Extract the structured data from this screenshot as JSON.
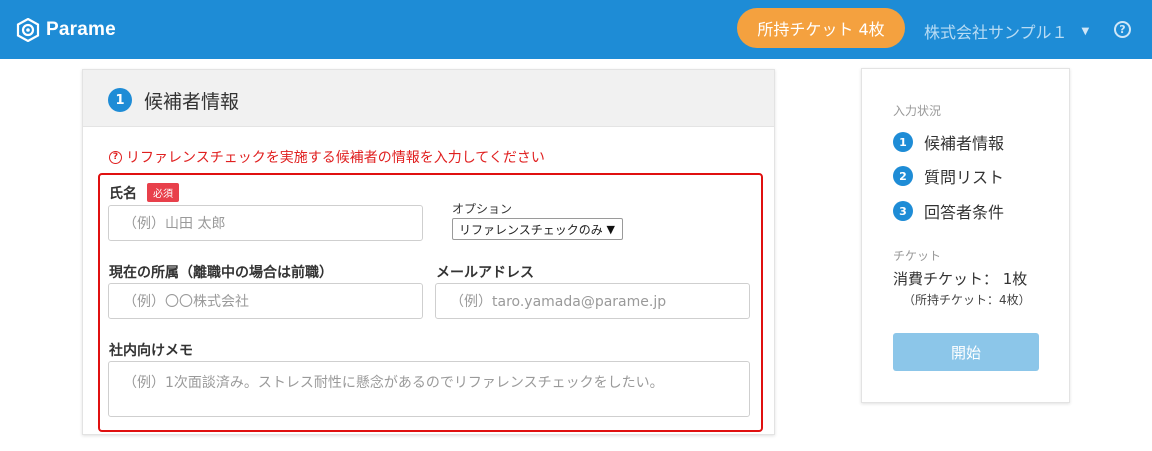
{
  "header": {
    "logo_text": "Parame",
    "ticket_button": "所持チケット 4枚",
    "company": "株式会社サンプル１",
    "help": "?"
  },
  "main": {
    "step_number": "1",
    "title": "候補者情報",
    "notice": "リファレンスチェックを実施する候補者の情報を入力してください",
    "fields": {
      "name_label": "氏名",
      "required_badge": "必須",
      "name_placeholder": "（例）山田 太郎",
      "option_label": "オプション",
      "option_selected": "リファレンスチェックのみ",
      "affiliation_label": "現在の所属（離職中の場合は前職）",
      "affiliation_placeholder": "（例）〇〇株式会社",
      "email_label": "メールアドレス",
      "email_placeholder": "（例）taro.yamada@parame.jp",
      "memo_label": "社内向けメモ",
      "memo_placeholder": "（例）1次面談済み。ストレス耐性に懸念があるのでリファレンスチェックをしたい。"
    }
  },
  "side": {
    "progress_caption": "入力状況",
    "steps": [
      {
        "num": "1",
        "label": "候補者情報"
      },
      {
        "num": "2",
        "label": "質問リスト"
      },
      {
        "num": "3",
        "label": "回答者条件"
      }
    ],
    "ticket_caption": "チケット",
    "consume": "消費チケット： 1枚",
    "owned": "（所持チケット：4枚）",
    "start_button": "開始"
  },
  "colors": {
    "header_bg": "#1e8cd6",
    "ticket_btn": "#f4a13f",
    "required": "#e8404b",
    "notice": "#e02020",
    "start_btn": "#8cc6e9"
  }
}
